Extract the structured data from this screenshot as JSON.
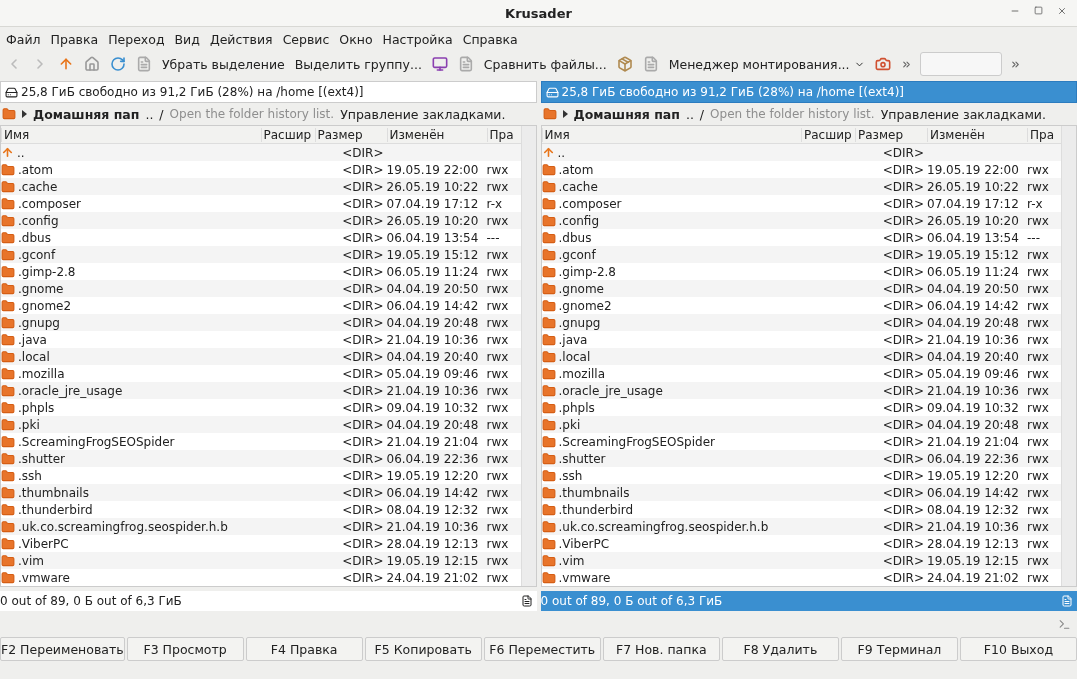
{
  "window": {
    "title": "Krusader"
  },
  "menu": [
    "Файл",
    "Правка",
    "Переход",
    "Вид",
    "Действия",
    "Сервис",
    "Окно",
    "Настройка",
    "Справка"
  ],
  "toolbar": {
    "buttons": [
      {
        "kind": "back"
      },
      {
        "kind": "forward"
      },
      {
        "kind": "up"
      },
      {
        "kind": "home"
      },
      {
        "kind": "refresh"
      },
      {
        "kind": "doc"
      },
      {
        "kind": "text",
        "label": "Убрать выделение"
      },
      {
        "kind": "text",
        "label": "Выделить группу..."
      },
      {
        "kind": "monitor"
      },
      {
        "kind": "doc"
      },
      {
        "kind": "text",
        "label": "Сравнить файлы..."
      },
      {
        "kind": "box"
      },
      {
        "kind": "doc"
      },
      {
        "kind": "menu",
        "label": "Менеджер монтирования..."
      },
      {
        "kind": "camera"
      },
      {
        "kind": "more"
      },
      {
        "kind": "field"
      },
      {
        "kind": "more"
      }
    ]
  },
  "panels": [
    {
      "active": false,
      "disk_info": "25,8 ГиБ свободно из 91,2 ГиБ (28%) на /home [(ext4)]",
      "breadcrumb": "Домашняя пап",
      "breadcrumb_more": "..",
      "path": "/",
      "history_placeholder": "Open the folder history list.",
      "bookmarks": "Управление закладками.",
      "columns": [
        "Имя",
        "Расшир",
        "Размер",
        "Изменён",
        "Пра"
      ],
      "rows": [
        {
          "kind": "up",
          "name": "..",
          "size": "<DIR>"
        },
        {
          "kind": "dir",
          "name": ".atom",
          "size": "<DIR>",
          "modified": "19.05.19 22:00",
          "perms": "rwx"
        },
        {
          "kind": "dir",
          "name": ".cache",
          "size": "<DIR>",
          "modified": "26.05.19 10:22",
          "perms": "rwx"
        },
        {
          "kind": "dir",
          "name": ".composer",
          "size": "<DIR>",
          "modified": "07.04.19 17:12",
          "perms": "r-x"
        },
        {
          "kind": "dir",
          "name": ".config",
          "size": "<DIR>",
          "modified": "26.05.19 10:20",
          "perms": "rwx"
        },
        {
          "kind": "dir",
          "name": ".dbus",
          "size": "<DIR>",
          "modified": "06.04.19 13:54",
          "perms": "---"
        },
        {
          "kind": "dir",
          "name": ".gconf",
          "size": "<DIR>",
          "modified": "19.05.19 15:12",
          "perms": "rwx"
        },
        {
          "kind": "dir",
          "name": ".gimp-2.8",
          "size": "<DIR>",
          "modified": "06.05.19 11:24",
          "perms": "rwx"
        },
        {
          "kind": "dir",
          "name": ".gnome",
          "size": "<DIR>",
          "modified": "04.04.19 20:50",
          "perms": "rwx"
        },
        {
          "kind": "dir",
          "name": ".gnome2",
          "size": "<DIR>",
          "modified": "06.04.19 14:42",
          "perms": "rwx"
        },
        {
          "kind": "dir",
          "name": ".gnupg",
          "size": "<DIR>",
          "modified": "04.04.19 20:48",
          "perms": "rwx"
        },
        {
          "kind": "dir",
          "name": ".java",
          "size": "<DIR>",
          "modified": "21.04.19 10:36",
          "perms": "rwx"
        },
        {
          "kind": "dir",
          "name": ".local",
          "size": "<DIR>",
          "modified": "04.04.19 20:40",
          "perms": "rwx"
        },
        {
          "kind": "dir",
          "name": ".mozilla",
          "size": "<DIR>",
          "modified": "05.04.19 09:46",
          "perms": "rwx"
        },
        {
          "kind": "dir",
          "name": ".oracle_jre_usage",
          "size": "<DIR>",
          "modified": "21.04.19 10:36",
          "perms": "rwx"
        },
        {
          "kind": "dir",
          "name": ".phpls",
          "size": "<DIR>",
          "modified": "09.04.19 10:32",
          "perms": "rwx"
        },
        {
          "kind": "dir",
          "name": ".pki",
          "size": "<DIR>",
          "modified": "04.04.19 20:48",
          "perms": "rwx"
        },
        {
          "kind": "dir",
          "name": ".ScreamingFrogSEOSpider",
          "size": "<DIR>",
          "modified": "21.04.19 21:04",
          "perms": "rwx"
        },
        {
          "kind": "dir",
          "name": ".shutter",
          "size": "<DIR>",
          "modified": "06.04.19 22:36",
          "perms": "rwx"
        },
        {
          "kind": "dir",
          "name": ".ssh",
          "size": "<DIR>",
          "modified": "19.05.19 12:20",
          "perms": "rwx"
        },
        {
          "kind": "dir",
          "name": ".thumbnails",
          "size": "<DIR>",
          "modified": "06.04.19 14:42",
          "perms": "rwx"
        },
        {
          "kind": "dir",
          "name": ".thunderbird",
          "size": "<DIR>",
          "modified": "08.04.19 12:32",
          "perms": "rwx"
        },
        {
          "kind": "dir",
          "name": ".uk.co.screamingfrog.seospider.h.b",
          "size": "<DIR>",
          "modified": "21.04.19 10:36",
          "perms": "rwx"
        },
        {
          "kind": "dir",
          "name": ".ViberPC",
          "size": "<DIR>",
          "modified": "28.04.19 12:13",
          "perms": "rwx"
        },
        {
          "kind": "dir",
          "name": ".vim",
          "size": "<DIR>",
          "modified": "19.05.19 12:15",
          "perms": "rwx"
        },
        {
          "kind": "dir",
          "name": ".vmware",
          "size": "<DIR>",
          "modified": "24.04.19 21:02",
          "perms": "rwx"
        }
      ],
      "status": "0 out of 89, 0 Б out of 6,3 ГиБ"
    },
    {
      "active": true,
      "disk_info": "25,8 ГиБ свободно из 91,2 ГиБ (28%) на /home [(ext4)]",
      "breadcrumb": "Домашняя пап",
      "breadcrumb_more": "..",
      "path": "/",
      "history_placeholder": "Open the folder history list.",
      "bookmarks": "Управление закладками.",
      "columns": [
        "Имя",
        "Расшир",
        "Размер",
        "Изменён",
        "Пра"
      ],
      "rows": [
        {
          "kind": "up",
          "name": "..",
          "size": "<DIR>"
        },
        {
          "kind": "dir",
          "name": ".atom",
          "size": "<DIR>",
          "modified": "19.05.19 22:00",
          "perms": "rwx"
        },
        {
          "kind": "dir",
          "name": ".cache",
          "size": "<DIR>",
          "modified": "26.05.19 10:22",
          "perms": "rwx"
        },
        {
          "kind": "dir",
          "name": ".composer",
          "size": "<DIR>",
          "modified": "07.04.19 17:12",
          "perms": "r-x"
        },
        {
          "kind": "dir",
          "name": ".config",
          "size": "<DIR>",
          "modified": "26.05.19 10:20",
          "perms": "rwx"
        },
        {
          "kind": "dir",
          "name": ".dbus",
          "size": "<DIR>",
          "modified": "06.04.19 13:54",
          "perms": "---"
        },
        {
          "kind": "dir",
          "name": ".gconf",
          "size": "<DIR>",
          "modified": "19.05.19 15:12",
          "perms": "rwx"
        },
        {
          "kind": "dir",
          "name": ".gimp-2.8",
          "size": "<DIR>",
          "modified": "06.05.19 11:24",
          "perms": "rwx"
        },
        {
          "kind": "dir",
          "name": ".gnome",
          "size": "<DIR>",
          "modified": "04.04.19 20:50",
          "perms": "rwx"
        },
        {
          "kind": "dir",
          "name": ".gnome2",
          "size": "<DIR>",
          "modified": "06.04.19 14:42",
          "perms": "rwx"
        },
        {
          "kind": "dir",
          "name": ".gnupg",
          "size": "<DIR>",
          "modified": "04.04.19 20:48",
          "perms": "rwx"
        },
        {
          "kind": "dir",
          "name": ".java",
          "size": "<DIR>",
          "modified": "21.04.19 10:36",
          "perms": "rwx"
        },
        {
          "kind": "dir",
          "name": ".local",
          "size": "<DIR>",
          "modified": "04.04.19 20:40",
          "perms": "rwx"
        },
        {
          "kind": "dir",
          "name": ".mozilla",
          "size": "<DIR>",
          "modified": "05.04.19 09:46",
          "perms": "rwx"
        },
        {
          "kind": "dir",
          "name": ".oracle_jre_usage",
          "size": "<DIR>",
          "modified": "21.04.19 10:36",
          "perms": "rwx"
        },
        {
          "kind": "dir",
          "name": ".phpls",
          "size": "<DIR>",
          "modified": "09.04.19 10:32",
          "perms": "rwx"
        },
        {
          "kind": "dir",
          "name": ".pki",
          "size": "<DIR>",
          "modified": "04.04.19 20:48",
          "perms": "rwx"
        },
        {
          "kind": "dir",
          "name": ".ScreamingFrogSEOSpider",
          "size": "<DIR>",
          "modified": "21.04.19 21:04",
          "perms": "rwx"
        },
        {
          "kind": "dir",
          "name": ".shutter",
          "size": "<DIR>",
          "modified": "06.04.19 22:36",
          "perms": "rwx"
        },
        {
          "kind": "dir",
          "name": ".ssh",
          "size": "<DIR>",
          "modified": "19.05.19 12:20",
          "perms": "rwx"
        },
        {
          "kind": "dir",
          "name": ".thumbnails",
          "size": "<DIR>",
          "modified": "06.04.19 14:42",
          "perms": "rwx"
        },
        {
          "kind": "dir",
          "name": ".thunderbird",
          "size": "<DIR>",
          "modified": "08.04.19 12:32",
          "perms": "rwx"
        },
        {
          "kind": "dir",
          "name": ".uk.co.screamingfrog.seospider.h.b",
          "size": "<DIR>",
          "modified": "21.04.19 10:36",
          "perms": "rwx"
        },
        {
          "kind": "dir",
          "name": ".ViberPC",
          "size": "<DIR>",
          "modified": "28.04.19 12:13",
          "perms": "rwx"
        },
        {
          "kind": "dir",
          "name": ".vim",
          "size": "<DIR>",
          "modified": "19.05.19 12:15",
          "perms": "rwx"
        },
        {
          "kind": "dir",
          "name": ".vmware",
          "size": "<DIR>",
          "modified": "24.04.19 21:02",
          "perms": "rwx"
        }
      ],
      "status": "0 out of 89, 0 Б out of 6,3 ГиБ"
    }
  ],
  "function_keys": [
    "F2 Переименовать",
    "F3 Просмотр",
    "F4 Правка",
    "F5 Копировать",
    "F6 Переместить",
    "F7 Нов. папка",
    "F8 Удалить",
    "F9 Терминал",
    "F10 Выход"
  ]
}
